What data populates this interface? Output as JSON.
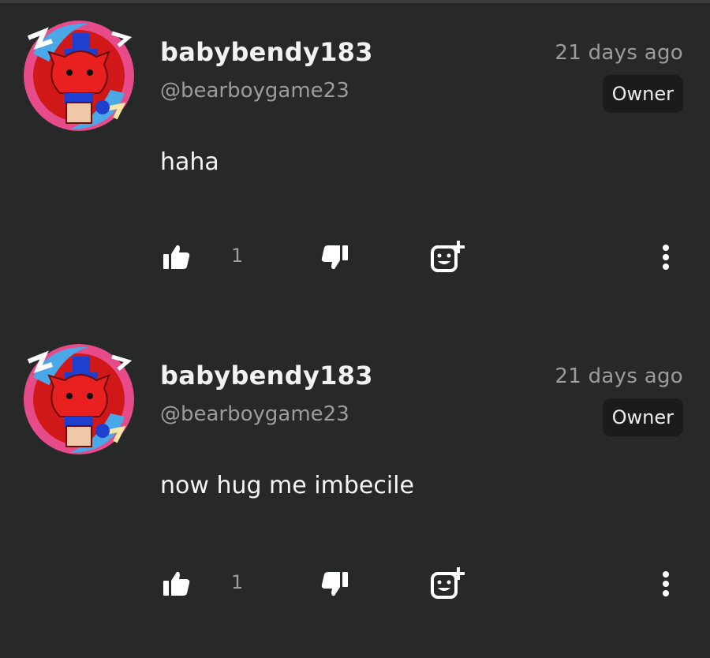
{
  "comments": [
    {
      "username": "babybendy183",
      "handle": "@bearboygame23",
      "time": "21 days ago",
      "badge": "Owner",
      "text": "haha",
      "likes": "1"
    },
    {
      "username": "babybendy183",
      "handle": "@bearboygame23",
      "time": "21 days ago",
      "badge": "Owner",
      "text": "now hug me imbecile",
      "likes": "1"
    }
  ],
  "icons": {
    "like": "thumbs-up-icon",
    "dislike": "thumbs-down-icon",
    "react": "add-reaction-icon",
    "more": "more-vertical-icon"
  },
  "colors": {
    "background": "#272929",
    "badge_bg": "#1a1c1c",
    "muted_text": "#9b9d9d"
  }
}
